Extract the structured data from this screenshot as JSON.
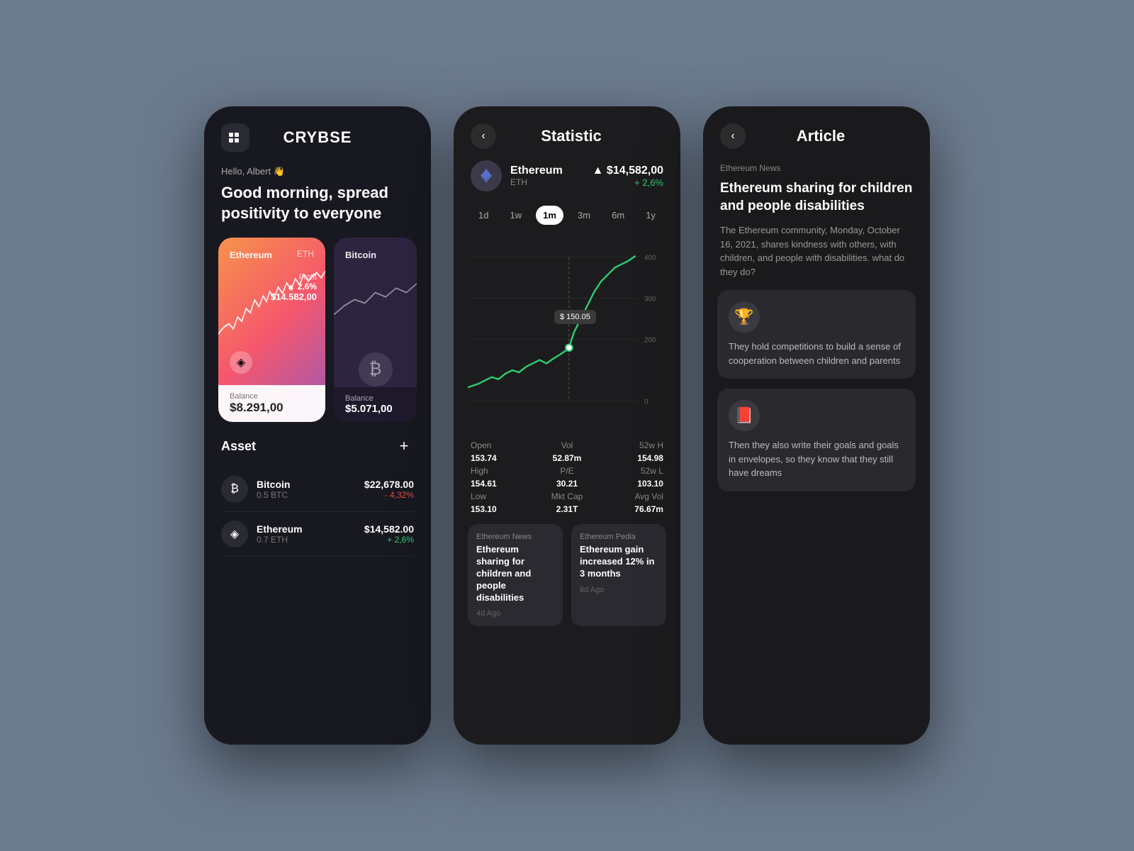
{
  "bg_color": "#6b7a8d",
  "phone1": {
    "menu_icon": "⠿",
    "logo": "CRYBSE",
    "greeting": "Hello, Albert 👋",
    "message": "Good morning, spread positivity to everyone",
    "card_eth": {
      "label": "Ethereum",
      "ticker": "ETH",
      "profit_label": "Profit",
      "profit_pct": "▲ 2,6%",
      "profit_val": "$14.582,00",
      "balance_label": "Balance",
      "balance_val": "$8.291,00"
    },
    "card_btc": {
      "label": "Bitcoin",
      "balance_label": "Balance",
      "balance_val": "$5.071,00"
    },
    "asset_section": {
      "title": "Asset",
      "add": "+",
      "items": [
        {
          "icon": "₿",
          "name": "Bitcoin",
          "qty": "0.5 BTC",
          "price": "$22,678.00",
          "change": "- 4,32%",
          "change_type": "neg"
        },
        {
          "icon": "◈",
          "name": "Ethereum",
          "qty": "0.7 ETH",
          "price": "$14,582.00",
          "change": "+ 2,6%",
          "change_type": "pos"
        }
      ]
    }
  },
  "phone2": {
    "back": "‹",
    "title": "Statistic",
    "coin": {
      "name": "Ethereum",
      "symbol": "ETH",
      "price": "$14,582,00",
      "change": "+ 2,6%"
    },
    "timeframes": [
      "1d",
      "1w",
      "1m",
      "3m",
      "6m",
      "1y"
    ],
    "active_tf": "1m",
    "tooltip": "$ 150.05",
    "y_labels": [
      "400",
      "300",
      "200",
      "0"
    ],
    "stats": [
      {
        "label": "Open",
        "val": "153.74"
      },
      {
        "label": "Vol",
        "val": "52.87m"
      },
      {
        "label": "52w H",
        "val": "154.98"
      },
      {
        "label": "High",
        "val": "154.61"
      },
      {
        "label": "P/E",
        "val": "30.21"
      },
      {
        "label": "52w L",
        "val": "103.10"
      },
      {
        "label": "Low",
        "val": "153.10"
      },
      {
        "label": "Mkt Cap",
        "val": "2.31T"
      },
      {
        "label": "Avg Vol",
        "val": "76.67m"
      }
    ],
    "news": [
      {
        "source": "Ethereum News",
        "title": "Ethereum sharing for children and people disabilities",
        "age": "4d Ago"
      },
      {
        "source": "Ethereum Pedia",
        "title": "Ethereum gain increased 12% in 3 months",
        "age": "6d Ago"
      }
    ]
  },
  "phone3": {
    "back": "‹",
    "title": "Article",
    "source": "Ethereum News",
    "article_title": "Ethereum sharing for children and people disabilities",
    "article_desc": "The Ethereum community, Monday, October 16, 2021, shares kindness with others, with children, and people with disabilities. what do they do?",
    "blocks": [
      {
        "icon": "🏆",
        "text": "They hold competitions to build a sense of cooperation between children and parents"
      },
      {
        "icon": "📕",
        "text": "Then they also write their goals and goals in envelopes, so they know that they still have dreams"
      }
    ]
  }
}
